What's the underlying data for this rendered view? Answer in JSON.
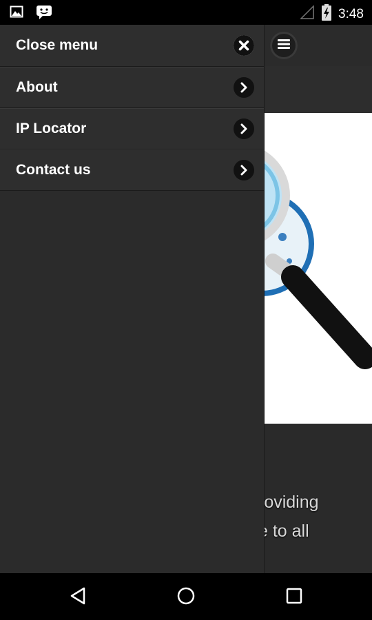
{
  "status_bar": {
    "time": "3:48",
    "icons": [
      "image-notification-icon",
      "messaging-notification-icon",
      "signal-icon",
      "battery-charging-icon"
    ]
  },
  "drawer": {
    "items": [
      {
        "label": "Close menu",
        "icon": "close-icon"
      },
      {
        "label": "About",
        "icon": "chevron-right-icon"
      },
      {
        "label": "IP Locator",
        "icon": "chevron-right-icon"
      },
      {
        "label": "Contact us",
        "icon": "chevron-right-icon"
      }
    ]
  },
  "background_page": {
    "menu_toggle_icon": "hamburger-menu-icon",
    "hero_image": "magnifying-glass-over-globe",
    "text_line_1": "roviding",
    "text_line_2": "e to all"
  },
  "nav_bar": {
    "buttons": [
      "back-icon",
      "home-icon",
      "recents-icon"
    ]
  }
}
